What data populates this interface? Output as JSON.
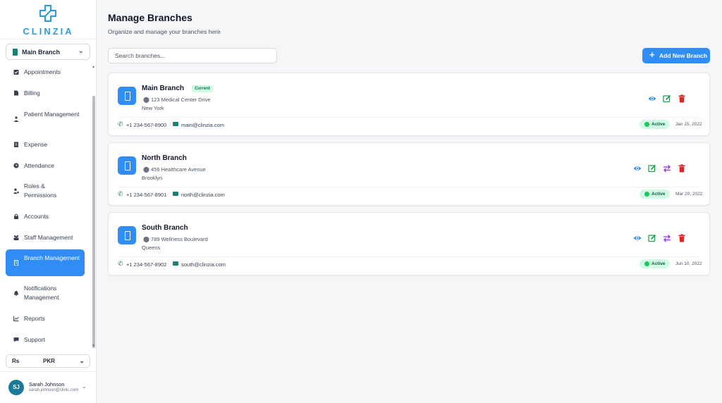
{
  "brand": {
    "name": "CLINZIA"
  },
  "branch_selector": {
    "selected": "Main Branch"
  },
  "nav": [
    {
      "label": "Appointments",
      "icon": "calendar-check-icon",
      "active": false
    },
    {
      "label": "Billing",
      "icon": "file-icon",
      "active": false
    },
    {
      "label": "Patient Management",
      "icon": "patient-icon",
      "active": false
    },
    {
      "label": "Expense",
      "icon": "receipt-icon",
      "active": false
    },
    {
      "label": "Attendance",
      "icon": "clock-icon",
      "active": false
    },
    {
      "label": "Roles & Permissions",
      "icon": "user-cog-icon",
      "active": false
    },
    {
      "label": "Accounts",
      "icon": "lock-icon",
      "active": false
    },
    {
      "label": "Staff Management",
      "icon": "group-icon",
      "active": false
    },
    {
      "label": "Branch Management",
      "icon": "building-icon",
      "active": true
    },
    {
      "label": "Notifications Management",
      "icon": "bell-icon",
      "active": false
    },
    {
      "label": "Reports",
      "icon": "chart-line-icon",
      "active": false
    },
    {
      "label": "Support",
      "icon": "chat-icon",
      "active": false
    }
  ],
  "currency": {
    "symbol": "Rs",
    "code": "PKR"
  },
  "user": {
    "initials": "SJ",
    "name": "Sarah Johnson",
    "email": "sarah.johnson@clinic.com"
  },
  "header": {
    "title": "Manage Branches",
    "subtitle": "Organize and manage your branches here"
  },
  "search": {
    "placeholder": "Search branches..."
  },
  "add_button": {
    "label": "Add New Branch"
  },
  "branches": [
    {
      "name": "Main Branch",
      "badge": "Current",
      "address": "123 Medical Center Drive",
      "city": "New York",
      "phone": "+1 234-567-8900",
      "email": "main@clinzia.com",
      "status": "Active",
      "date": "Jan 15, 2022",
      "actions": [
        "view",
        "edit",
        "delete"
      ]
    },
    {
      "name": "North Branch",
      "badge": "",
      "address": "456 Healthcare Avenue",
      "city": "Brooklyn",
      "phone": "+1 234-567-8901",
      "email": "north@clinzia.com",
      "status": "Active",
      "date": "Mar 20, 2022",
      "actions": [
        "view",
        "edit",
        "switch",
        "delete"
      ]
    },
    {
      "name": "South Branch",
      "badge": "",
      "address": "789 Wellness Boulevard",
      "city": "Queens",
      "phone": "+1 234-567-8902",
      "email": "south@clinzia.com",
      "status": "Active",
      "date": "Jun 10, 2022",
      "actions": [
        "view",
        "edit",
        "switch",
        "delete"
      ]
    }
  ],
  "colors": {
    "accent": "#2f8df5",
    "teal": "#1a7f75",
    "success": "#22c55e",
    "danger": "#dc2626",
    "switch": "#9333ea"
  }
}
